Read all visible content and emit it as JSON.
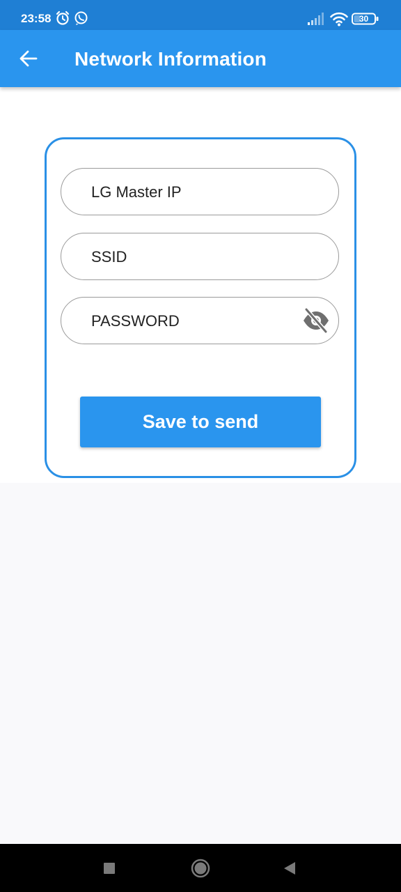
{
  "status_bar": {
    "time": "23:58",
    "battery_level": "30",
    "icons": [
      "alarm-icon",
      "whatsapp-icon",
      "signal-icon",
      "wifi-icon",
      "battery-icon"
    ]
  },
  "app_bar": {
    "title": "Network Information",
    "back_icon": "arrow-left-icon"
  },
  "form": {
    "master_ip": {
      "placeholder": "LG Master IP",
      "value": ""
    },
    "ssid": {
      "placeholder": "SSID",
      "value": ""
    },
    "password": {
      "placeholder": "PASSWORD",
      "value": "",
      "toggle_icon": "eye-off-icon"
    },
    "save_label": "Save to send"
  },
  "nav_bar": {
    "buttons": [
      "recents-square-icon",
      "home-circle-icon",
      "back-triangle-icon"
    ]
  },
  "colors": {
    "status_bar": "#1f7fd4",
    "app_bar": "#2a95ee",
    "card_border": "#2a90e6",
    "button": "#2a95ee",
    "field_border": "#9a9a9a"
  }
}
